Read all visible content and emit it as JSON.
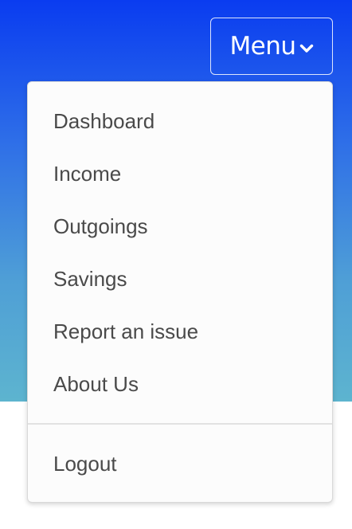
{
  "header": {
    "menu_button_label": "Menu",
    "menu_button_icon": "chevron-down-icon"
  },
  "dropdown": {
    "items": [
      {
        "label": "Dashboard"
      },
      {
        "label": "Income"
      },
      {
        "label": "Outgoings"
      },
      {
        "label": "Savings"
      },
      {
        "label": "Report an issue"
      },
      {
        "label": "About Us"
      }
    ],
    "footer_item": {
      "label": "Logout"
    }
  },
  "colors": {
    "gradient_top": "#0a3cf0",
    "gradient_bottom": "#5db4cf",
    "menu_text": "#4a4a4a"
  }
}
